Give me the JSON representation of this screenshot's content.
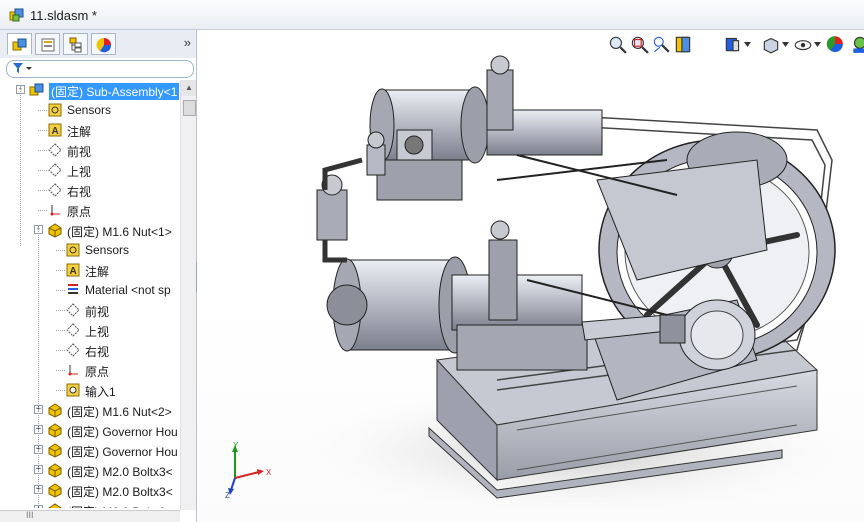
{
  "window": {
    "title": "11.sldasm *"
  },
  "panel_tabs": [
    {
      "name": "featuremanager",
      "icon": "assembly-tree-icon"
    },
    {
      "name": "propertymanager",
      "icon": "property-manager-icon"
    },
    {
      "name": "configurationmanager",
      "icon": "configuration-manager-icon"
    },
    {
      "name": "displaymanager",
      "icon": "display-manager-icon"
    }
  ],
  "panel_more": "»",
  "tree": [
    {
      "level": 0,
      "expander": "-",
      "icon": "subassembly-icon",
      "label": "(固定) Sub-Assembly<1",
      "selected": true
    },
    {
      "level": 1,
      "expander": "",
      "icon": "sensors-icon",
      "label": "Sensors"
    },
    {
      "level": 1,
      "expander": "",
      "icon": "annotation-icon",
      "label": "注解"
    },
    {
      "level": 1,
      "expander": "",
      "icon": "plane-icon",
      "label": "前视"
    },
    {
      "level": 1,
      "expander": "",
      "icon": "plane-icon",
      "label": "上视"
    },
    {
      "level": 1,
      "expander": "",
      "icon": "plane-icon",
      "label": "右视"
    },
    {
      "level": 1,
      "expander": "",
      "icon": "origin-icon",
      "label": "原点"
    },
    {
      "level": 1,
      "expander": "-",
      "icon": "part-icon",
      "label": "(固定) M1.6 Nut<1>"
    },
    {
      "level": 2,
      "expander": "",
      "icon": "sensors-icon",
      "label": "Sensors"
    },
    {
      "level": 2,
      "expander": "",
      "icon": "annotation-icon",
      "label": "注解"
    },
    {
      "level": 2,
      "expander": "",
      "icon": "material-icon",
      "label": "Material <not sp"
    },
    {
      "level": 2,
      "expander": "",
      "icon": "plane-icon",
      "label": "前视"
    },
    {
      "level": 2,
      "expander": "",
      "icon": "plane-icon",
      "label": "上视"
    },
    {
      "level": 2,
      "expander": "",
      "icon": "plane-icon",
      "label": "右视"
    },
    {
      "level": 2,
      "expander": "",
      "icon": "origin-icon",
      "label": "原点"
    },
    {
      "level": 2,
      "expander": "",
      "icon": "import-icon",
      "label": "输入1"
    },
    {
      "level": 1,
      "expander": "+",
      "icon": "part-icon",
      "label": "(固定) M1.6 Nut<2>"
    },
    {
      "level": 1,
      "expander": "+",
      "icon": "part-icon",
      "label": "(固定) Governor Hou"
    },
    {
      "level": 1,
      "expander": "+",
      "icon": "part-icon",
      "label": "(固定) Governor Hou"
    },
    {
      "level": 1,
      "expander": "+",
      "icon": "part-icon",
      "label": "(固定) M2.0 Boltx3<"
    },
    {
      "level": 1,
      "expander": "+",
      "icon": "part-icon",
      "label": "(固定) M2.0 Boltx3<"
    },
    {
      "level": 1,
      "expander": "+",
      "icon": "part-icon",
      "label": "(固定) M2.0 Boltx3<"
    }
  ],
  "hscroll_grip": "III",
  "heads_up_toolbar": [
    "zoom-to-fit-icon",
    "zoom-to-area-icon",
    "previous-view-icon",
    "section-view-icon",
    "view-orientation-icon",
    "display-style-icon",
    "hide-show-icon",
    "edit-appearance-icon",
    "apply-scene-icon",
    "view-settings-icon"
  ],
  "triad": {
    "x": "X",
    "y": "Y",
    "z": "Z"
  },
  "colors": {
    "selection": "#3399ff",
    "triad_x": "#d62020",
    "triad_y": "#1c9a1c",
    "triad_z": "#2040c8",
    "model": "#b9bcc6"
  }
}
